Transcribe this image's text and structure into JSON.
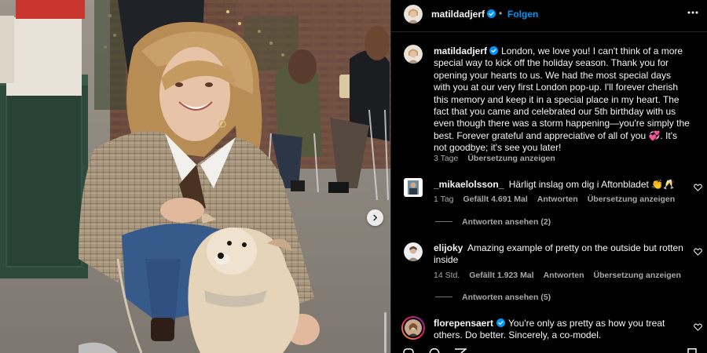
{
  "post": {
    "author": "matildadjerf",
    "follow_label": "Folgen",
    "separator": "•",
    "caption": "London, we love you! I can't think of a more special way to kick off the holiday season. Thank you for opening your hearts to us. We had the most special days with you at our very first London pop-up. I'll forever cherish this memory and keep it in a special place in my heart. The fact that you came and celebrated our 5th birthday with us even though there was a storm happening—you're simply the best. Forever grateful and appreciative of all of you 💞. It's not goodbye; it's see you later!",
    "time": "3 Tage",
    "translate_label": "Übersetzung anzeigen"
  },
  "comments": [
    {
      "username": "_mikaelolsson_",
      "text": "Härligt inslag om dig i Aftonbladet 👏🥂",
      "time": "1 Tag",
      "likes": "Gefällt 4.691 Mal",
      "reply_label": "Antworten",
      "translate_label": "Übersetzung anzeigen",
      "view_replies": "Antworten ansehen (2)"
    },
    {
      "username": "elijoky",
      "text": "Amazing example of pretty on the outside but rotten inside",
      "time": "14 Std.",
      "likes": "Gefällt 1.923 Mal",
      "reply_label": "Antworten",
      "translate_label": "Übersetzung anzeigen",
      "view_replies": "Antworten ansehen (5)"
    },
    {
      "username": "florepensaert",
      "text": "You're only as pretty as how you treat others. Do better. Sincerely, a co-model."
    }
  ],
  "colors": {
    "link_blue": "#0095f6",
    "verified_blue": "#0095f6",
    "secondary_text": "#a8a8a8",
    "divider": "#262626"
  },
  "icons": {
    "verified": "verified-badge-icon",
    "more": "more-horizontal-icon",
    "heart": "heart-outline-icon",
    "next": "chevron-right-icon"
  }
}
